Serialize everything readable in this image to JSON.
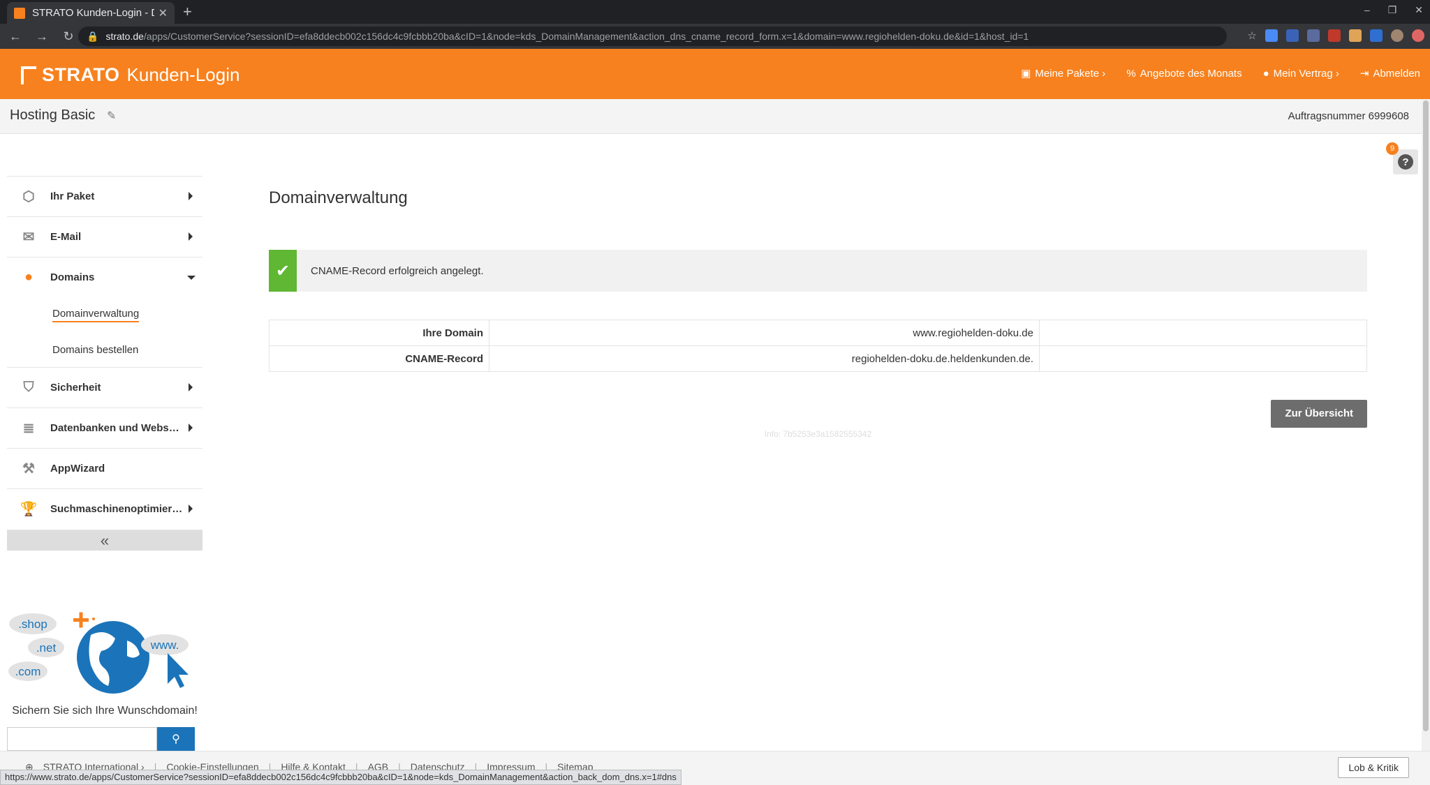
{
  "browser": {
    "tab_title": "STRATO Kunden-Login - D",
    "tab_close": "✕",
    "new_tab": "+",
    "url_host": "strato.de",
    "url_path": "/apps/CustomerService?sessionID=efa8ddecb002c156dc4c9fcbbb20ba&cID=1&node=kds_DomainManagement&action_dns_cname_record_form.x=1&domain=www.regiohelden-doku.de&id=1&host_id=1",
    "status_url": "https://www.strato.de/apps/CustomerService?sessionID=efa8ddecb002c156dc4c9fcbbb20ba&cID=1&node=kds_DomainManagement&action_back_dom_dns.x=1#dns"
  },
  "header": {
    "brand": "STRATO",
    "subtitle": "Kunden-Login",
    "menu": [
      {
        "label": "Meine Pakete ›"
      },
      {
        "label": "Angebote des Monats"
      },
      {
        "label": "Mein Vertrag ›"
      },
      {
        "label": "Abmelden"
      }
    ]
  },
  "subheader": {
    "package_title": "Hosting Basic",
    "order_number": "Auftragsnummer 6999608"
  },
  "sidebar": {
    "items": [
      {
        "label": "Ihr Paket"
      },
      {
        "label": "E-Mail"
      },
      {
        "label": "Domains"
      },
      {
        "label": "Sicherheit"
      },
      {
        "label": "Datenbanken und Webspace"
      },
      {
        "label": "AppWizard"
      },
      {
        "label": "Suchmaschinenoptimierung"
      }
    ],
    "subitems": [
      {
        "label": "Domainverwaltung"
      },
      {
        "label": "Domains bestellen"
      }
    ],
    "collapse": "«"
  },
  "promo": {
    "tld_shop": ".shop",
    "tld_net": ".net",
    "tld_com": ".com",
    "tld_www": "www.",
    "text": "Sichern Sie sich Ihre Wunschdomain!",
    "search_placeholder": ""
  },
  "main": {
    "title": "Domainverwaltung",
    "alert": "CNAME-Record erfolgreich angelegt.",
    "rows": [
      {
        "key": "Ihre Domain",
        "value": "www.regiohelden-doku.de"
      },
      {
        "key": "CNAME-Record",
        "value": "regiohelden-doku.de.heldenkunden.de."
      }
    ],
    "button": "Zur Übersicht",
    "info": "Info: 7b5253e3a1582555342"
  },
  "help": {
    "badge": "9",
    "icon": "?"
  },
  "footer": {
    "links": [
      "STRATO International ›",
      "Cookie-Einstellungen",
      "Hilfe & Kontakt",
      "AGB",
      "Datenschutz",
      "Impressum",
      "Sitemap"
    ],
    "feedback": "Lob & Kritik"
  },
  "colors": {
    "accent": "#f7811e",
    "success": "#5fb733",
    "button": "#6d6d6d",
    "search_button": "#1b74b9"
  }
}
